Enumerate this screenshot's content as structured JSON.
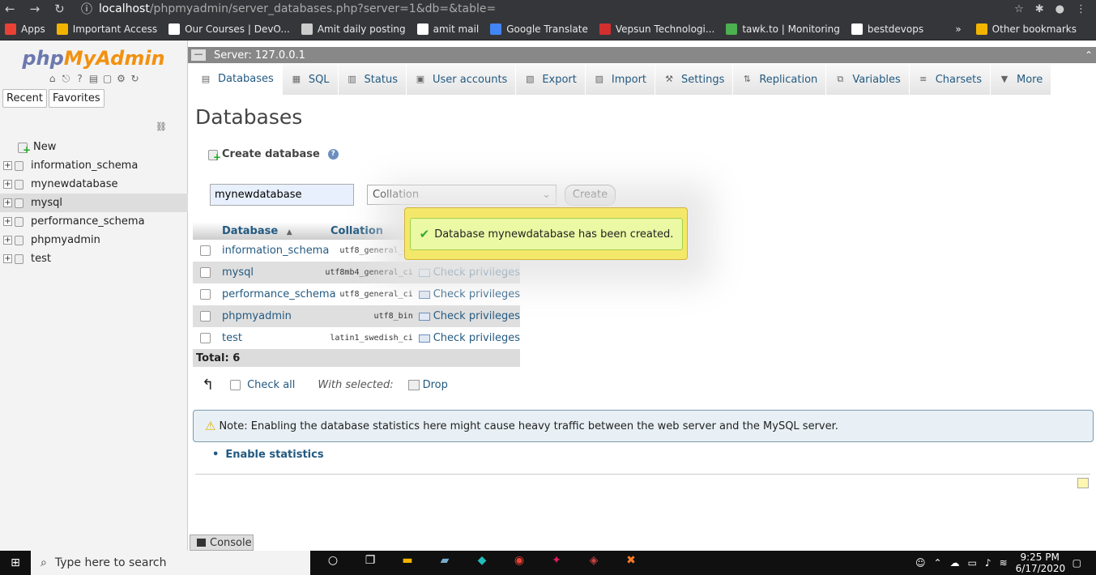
{
  "browser": {
    "url_host": "localhost",
    "url_path": "/phpmyadmin/server_databases.php?server=1&db=&table=",
    "bookmarks": [
      {
        "label": "Apps",
        "color": "#e94235"
      },
      {
        "label": "Important Access",
        "color": "#f3b400"
      },
      {
        "label": "Our Courses | DevO...",
        "color": "#ffffff"
      },
      {
        "label": "Amit daily posting",
        "color": "#cccccc"
      },
      {
        "label": "amit mail",
        "color": "#ffffff"
      },
      {
        "label": "Google Translate",
        "color": "#4285f4"
      },
      {
        "label": "Vepsun Technologi...",
        "color": "#d32f2f"
      },
      {
        "label": "tawk.to | Monitoring",
        "color": "#4caf50"
      },
      {
        "label": "bestdevops",
        "color": "#ffffff"
      }
    ],
    "more_bookmarks": "»",
    "other_bookmarks": "Other bookmarks"
  },
  "sidebar": {
    "logo_php": "php",
    "logo_myadmin": "MyAdmin",
    "tab_recent": "Recent",
    "tab_favorites": "Favorites",
    "new_label": "New",
    "databases": [
      {
        "name": "information_schema",
        "selected": false
      },
      {
        "name": "mynewdatabase",
        "selected": false
      },
      {
        "name": "mysql",
        "selected": true
      },
      {
        "name": "performance_schema",
        "selected": false
      },
      {
        "name": "phpmyadmin",
        "selected": false
      },
      {
        "name": "test",
        "selected": false
      }
    ]
  },
  "topbar": {
    "server": "Server: 127.0.0.1"
  },
  "tabs": [
    {
      "label": "Databases",
      "icon": "database-icon",
      "active": true
    },
    {
      "label": "SQL",
      "icon": "sql-icon",
      "active": false
    },
    {
      "label": "Status",
      "icon": "status-icon",
      "active": false
    },
    {
      "label": "User accounts",
      "icon": "users-icon",
      "active": false
    },
    {
      "label": "Export",
      "icon": "export-icon",
      "active": false
    },
    {
      "label": "Import",
      "icon": "import-icon",
      "active": false
    },
    {
      "label": "Settings",
      "icon": "wrench-icon",
      "active": false
    },
    {
      "label": "Replication",
      "icon": "replication-icon",
      "active": false
    },
    {
      "label": "Variables",
      "icon": "variables-icon",
      "active": false
    },
    {
      "label": "Charsets",
      "icon": "charsets-icon",
      "active": false
    },
    {
      "label": "More",
      "icon": "chevron-down-icon",
      "active": false
    }
  ],
  "main": {
    "title": "Databases",
    "create_label": "Create database",
    "db_name_value": "mynewdatabase",
    "collation_value": "Collation",
    "create_button": "Create",
    "success_message": "Database mynewdatabase has been created.",
    "table": {
      "col_database": "Database",
      "col_collation": "Collation",
      "sort_indicator": "▲",
      "rows": [
        {
          "name": "information_schema",
          "collation": "utf8_general_ci",
          "privileges": "Check privileges"
        },
        {
          "name": "mysql",
          "collation": "utf8mb4_general_ci",
          "privileges": "Check privileges"
        },
        {
          "name": "performance_schema",
          "collation": "utf8_general_ci",
          "privileges": "Check privileges"
        },
        {
          "name": "phpmyadmin",
          "collation": "utf8_bin",
          "privileges": "Check privileges"
        },
        {
          "name": "test",
          "collation": "latin1_swedish_ci",
          "privileges": "Check privileges"
        }
      ],
      "total": "Total: 6"
    },
    "check_all": "Check all",
    "with_selected": "With selected:",
    "drop": "Drop",
    "note": "Note: Enabling the database statistics here might cause heavy traffic between the web server and the MySQL server.",
    "enable_statistics": "Enable statistics",
    "console": "Console"
  },
  "taskbar": {
    "search_placeholder": "Type here to search",
    "time": "9:25 PM",
    "date": "6/17/2020"
  }
}
